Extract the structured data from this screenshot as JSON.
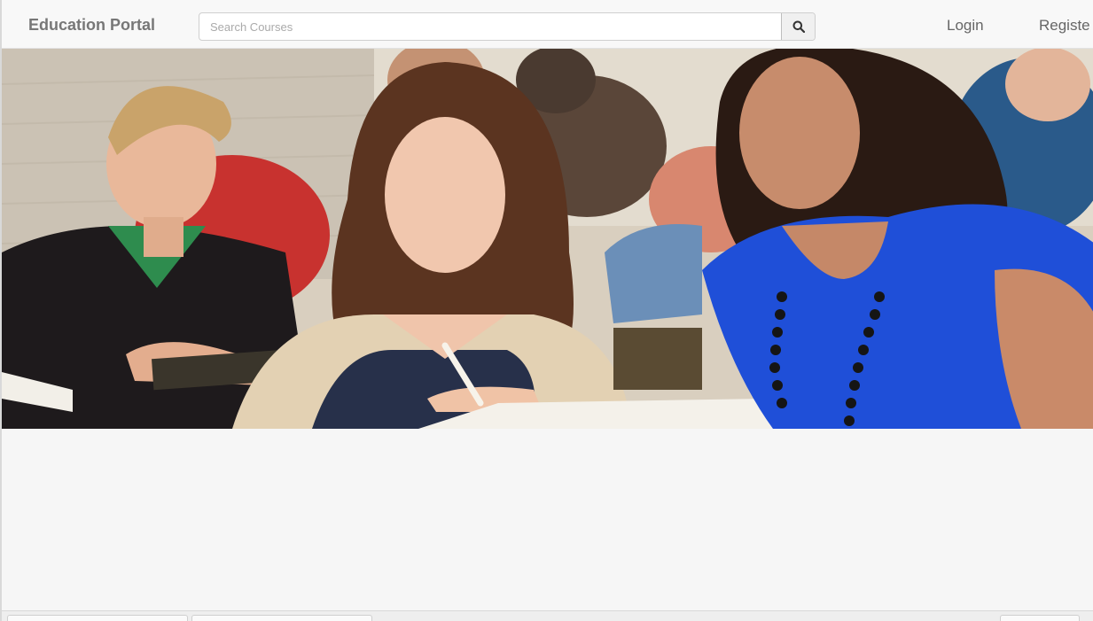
{
  "navbar": {
    "brand": "Education Portal",
    "search_placeholder": "Search Courses",
    "search_icon": "search-icon",
    "login": "Login",
    "register": "Registe"
  },
  "hero": {
    "image": "students-in-lecture-hall-photo"
  },
  "colors": {
    "navbar_bg": "#f8f8f8",
    "brand_text": "#777777",
    "page_bg": "#f6f6f6"
  }
}
